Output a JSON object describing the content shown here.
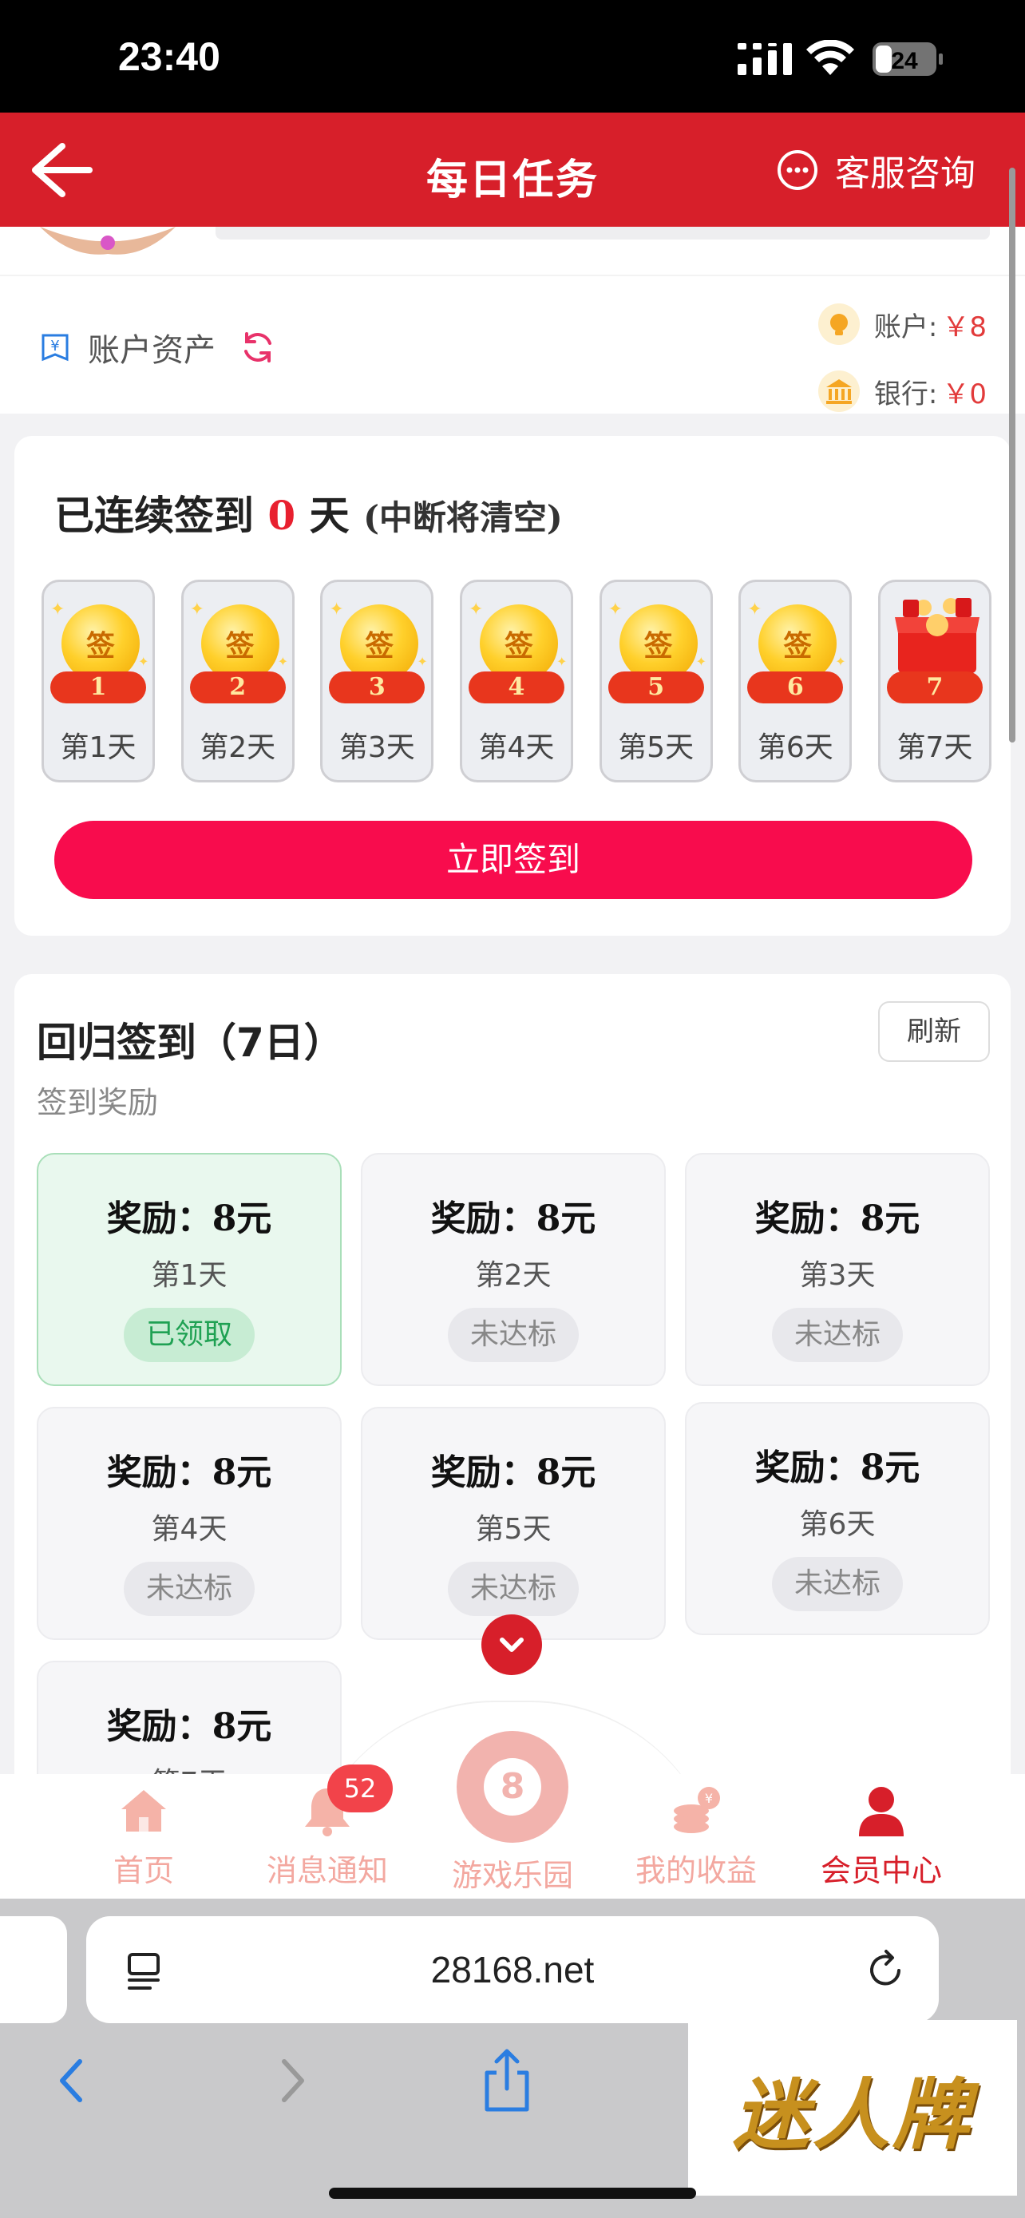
{
  "status": {
    "time": "23:40",
    "battery": "24"
  },
  "header": {
    "title": "每日任务",
    "service": "客服咨询"
  },
  "account": {
    "label": "账户资产",
    "balance_label": "账户:",
    "balance_value": "￥8",
    "bank_label": "银行:",
    "bank_value": "￥0"
  },
  "checkin": {
    "prefix": "已连续签到",
    "streak": "0",
    "unit": "天",
    "note": "(中断将清空)",
    "coin_text": "签",
    "days": [
      {
        "num": "1",
        "label": "第1天"
      },
      {
        "num": "2",
        "label": "第2天"
      },
      {
        "num": "3",
        "label": "第3天"
      },
      {
        "num": "4",
        "label": "第4天"
      },
      {
        "num": "5",
        "label": "第5天"
      },
      {
        "num": "6",
        "label": "第6天"
      },
      {
        "num": "7",
        "label": "第7天"
      }
    ],
    "button": "立即签到"
  },
  "return_signin": {
    "title": "回归签到（7日）",
    "subtitle": "签到奖励",
    "refresh": "刷新",
    "rewards": [
      {
        "amount_label": "奖励：",
        "amount": "8元",
        "day": "第1天",
        "status": "已领取"
      },
      {
        "amount_label": "奖励：",
        "amount": "8元",
        "day": "第2天",
        "status": "未达标"
      },
      {
        "amount_label": "奖励：",
        "amount": "8元",
        "day": "第3天",
        "status": "未达标"
      },
      {
        "amount_label": "奖励：",
        "amount": "8元",
        "day": "第4天",
        "status": "未达标"
      },
      {
        "amount_label": "奖励：",
        "amount": "8元",
        "day": "第5天",
        "status": "未达标"
      },
      {
        "amount_label": "奖励：",
        "amount": "8元",
        "day": "第6天",
        "status": "未达标"
      },
      {
        "amount_label": "奖励：",
        "amount": "8元",
        "day": "第7天",
        "status": ""
      }
    ]
  },
  "tabbar": {
    "items": [
      {
        "label": "首页"
      },
      {
        "label": "消息通知",
        "badge": "52"
      },
      {
        "label": "游戏乐园"
      },
      {
        "label": "我的收益"
      },
      {
        "label": "会员中心"
      }
    ],
    "ball_text": "8"
  },
  "browser": {
    "url": "28168.net"
  },
  "watermark": "迷人牌",
  "colors": {
    "brand_red": "#d71f2a",
    "button_pink": "#f80c4d",
    "claimed_green": "#1fa153"
  }
}
